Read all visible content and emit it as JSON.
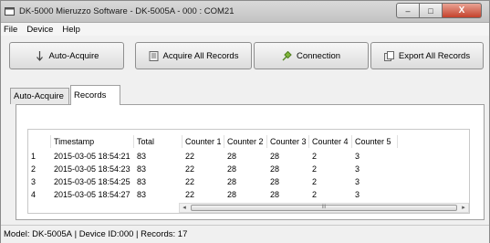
{
  "window": {
    "title": "DK-5000 Mieruzzo Software - DK-5005A - 000 : COM21",
    "controls": {
      "minimize": "–",
      "maximize": "□",
      "close": "X"
    }
  },
  "menu": [
    "File",
    "Device",
    "Help"
  ],
  "toolbar": {
    "auto_acquire": "Auto-Acquire",
    "acquire_all": "Acquire All Records",
    "connection": "Connection",
    "export_all": "Export All Records"
  },
  "tabs": [
    "Auto-Acquire",
    "Records"
  ],
  "active_tab": "Records",
  "table": {
    "columns": [
      "",
      "Timestamp",
      "Total",
      "Counter 1",
      "Counter 2",
      "Counter 3",
      "Counter 4",
      "Counter 5"
    ],
    "rows": [
      [
        "1",
        "2015-03-05 18:54:21",
        "83",
        "22",
        "28",
        "28",
        "2",
        "3"
      ],
      [
        "2",
        "2015-03-05 18:54:23",
        "83",
        "22",
        "28",
        "28",
        "2",
        "3"
      ],
      [
        "3",
        "2015-03-05 18:54:25",
        "83",
        "22",
        "28",
        "28",
        "2",
        "3"
      ],
      [
        "4",
        "2015-03-05 18:54:27",
        "83",
        "22",
        "28",
        "28",
        "2",
        "3"
      ]
    ],
    "scroll_thumb": "III"
  },
  "status": {
    "model": "Model: DK-5005A",
    "sep1": " | ",
    "device": "Device ID:000",
    "sep2": " | ",
    "records": "Records: 17"
  }
}
